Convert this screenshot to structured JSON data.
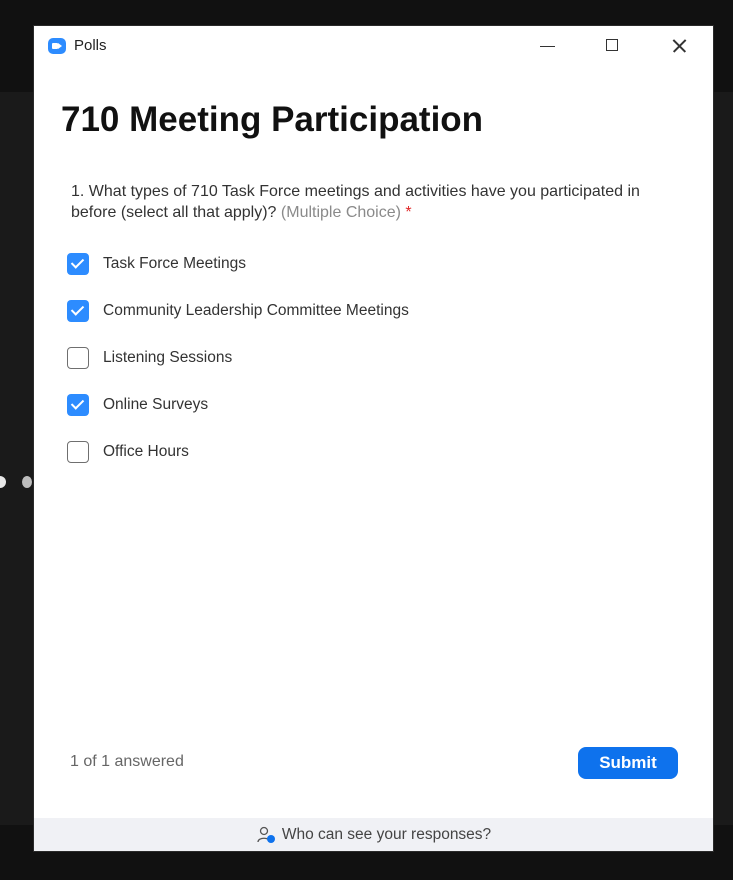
{
  "window": {
    "title": "Polls"
  },
  "poll": {
    "title": "710 Meeting Participation",
    "question": {
      "text": "1. What types of 710 Task Force meetings and activities have you participated in before (select all that apply)?",
      "type_label": "(Multiple Choice)",
      "required_marker": "*"
    },
    "options": [
      {
        "label": "Task Force Meetings",
        "checked": true
      },
      {
        "label": "Community Leadership Committee Meetings",
        "checked": true
      },
      {
        "label": "Listening Sessions",
        "checked": false
      },
      {
        "label": "Online Surveys",
        "checked": true
      },
      {
        "label": "Office Hours",
        "checked": false
      }
    ]
  },
  "footer": {
    "answered": "1 of 1 answered",
    "submit_label": "Submit",
    "visibility_link": "Who can see your responses?"
  },
  "colors": {
    "accent": "#2d8cff",
    "submit": "#0e72ed",
    "required": "#e02828"
  }
}
